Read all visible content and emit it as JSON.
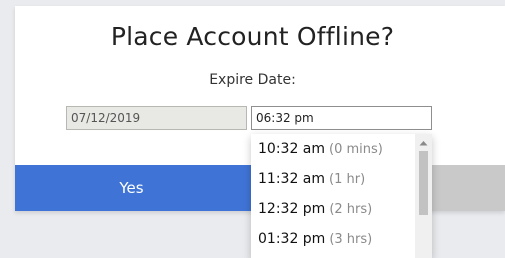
{
  "dialog": {
    "title": "Place Account Offline?",
    "expire_label": "Expire Date:",
    "date_value": "07/12/2019",
    "time_value": "06:32 pm",
    "yes_label": "Yes"
  },
  "time_dropdown": {
    "options": [
      {
        "time": "10:32 am",
        "hint": "(0 mins)"
      },
      {
        "time": "11:32 am",
        "hint": "(1 hr)"
      },
      {
        "time": "12:32 pm",
        "hint": "(2 hrs)"
      },
      {
        "time": "01:32 pm",
        "hint": "(3 hrs)"
      }
    ]
  },
  "colors": {
    "primary_button": "#3f74d6",
    "secondary_button": "#c9c9c9",
    "disabled_input": "#e8e8e4",
    "background": "#e9ebee"
  },
  "icons": {
    "scroll_up": "arrow-up-icon"
  }
}
